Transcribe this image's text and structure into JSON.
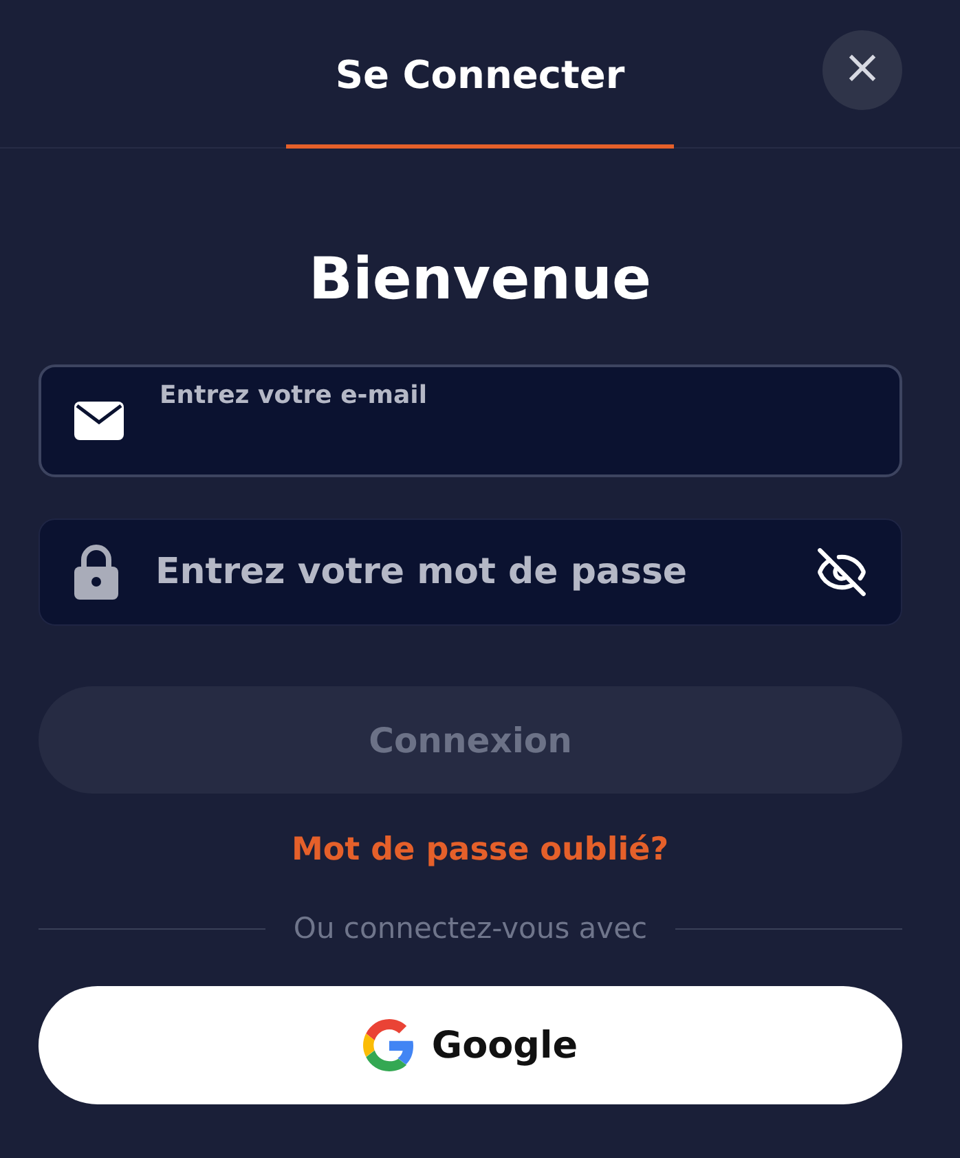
{
  "header": {
    "tabs": [
      {
        "label": "Se Connecter",
        "selected": true
      }
    ],
    "close_icon": "×"
  },
  "heading": "Bienvenue",
  "fields": [
    {
      "kind": "email",
      "placeholder": "Entrez votre e-mail",
      "focused": true
    },
    {
      "kind": "password",
      "placeholder": "Entrez votre mot de passe",
      "focused": false,
      "password_visible": false
    }
  ],
  "submit": {
    "label": "Connexion",
    "disabled": true
  },
  "forgot_link": "Mot de passe oublié?",
  "divider_text": "Ou connectez-vous avec",
  "social_buttons": [
    {
      "kind": "google",
      "label": "Google"
    }
  ]
}
